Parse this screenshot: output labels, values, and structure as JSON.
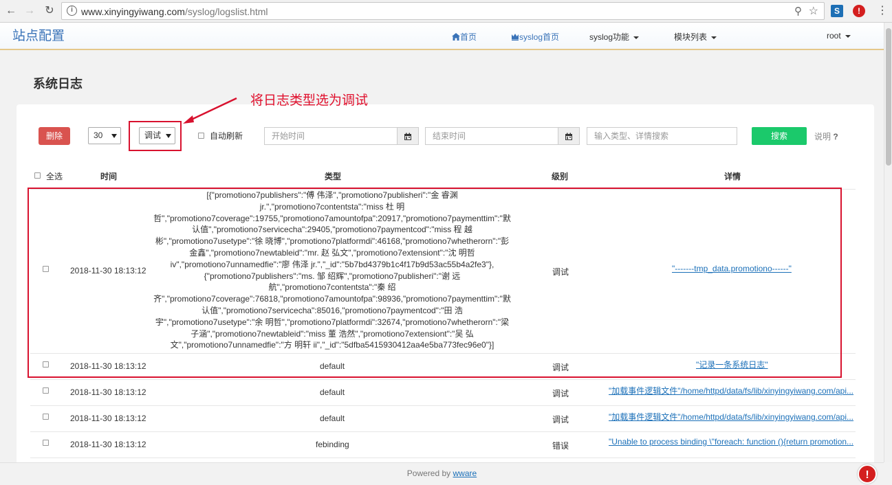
{
  "browser": {
    "url_host": "www.xinyingyiwang.com",
    "url_path": "/syslog/logslist.html",
    "ext1_label": "S",
    "ext2_label": "!"
  },
  "site": {
    "brand": "站点配置",
    "nav": {
      "home": "首页",
      "syslog_home": "syslog首页",
      "syslog_func": "syslog功能",
      "modules": "模块列表",
      "user": "root"
    }
  },
  "page": {
    "title": "系统日志",
    "annotation": "将日志类型选为调试"
  },
  "toolbar": {
    "delete_label": "删除",
    "page_size": "30",
    "level_filter": "调试",
    "auto_refresh_label": "自动刷新",
    "start_placeholder": "开始时间",
    "end_placeholder": "结束时间",
    "search_placeholder": "输入类型、详情搜索",
    "search_label": "搜索",
    "help_label": "说明",
    "help_mark": "?"
  },
  "table": {
    "headers": {
      "select_all": "全选",
      "time": "时间",
      "type": "类型",
      "level": "级别",
      "detail": "详情"
    },
    "rows": [
      {
        "time": "2018-11-30 18:13:12",
        "type": "[{\"promotiono7publishers\":\"傅 伟泽\",\"promotiono7publisheri\":\"金 睿渊 jr.\",\"promotiono7contentsta\":\"miss 杜 明哲\",\"promotiono7coverage\":19755,\"promotiono7amountofpa\":20917,\"promotiono7paymenttim\":\"默认值\",\"promotiono7servicecha\":29405,\"promotiono7paymentcod\":\"miss 程 越彬\",\"promotiono7usetype\":\"徐 晓博\",\"promotiono7platformdi\":46168,\"promotiono7whetherorn\":\"彭 金鑫\",\"promotiono7newtableid\":\"mr. 赵 弘文\",\"promotiono7extensiont\":\"沈 明哲 iv\",\"promotiono7unnamedfie\":\"廖 伟泽 jr.\",\"_id\":\"5b7bd4379b1c4f17b9d53ac55b4a2fe3\"},{\"promotiono7publishers\":\"ms. 邹 绍辉\",\"promotiono7publisheri\":\"谢 远航\",\"promotiono7contentsta\":\"秦 绍齐\",\"promotiono7coverage\":76818,\"promotiono7amountofpa\":98936,\"promotiono7paymenttim\":\"默认值\",\"promotiono7servicecha\":85016,\"promotiono7paymentcod\":\"田 浩宇\",\"promotiono7usetype\":\"余 明哲\",\"promotiono7platformdi\":32674,\"promotiono7whetherorn\":\"梁 子涵\",\"promotiono7newtableid\":\"miss 董 浩然\",\"promotiono7extensiont\":\"吴 弘文\",\"promotiono7unnamedfie\":\"方 明轩 ii\",\"_id\":\"5dfba5415930412aa4e5ba773fec96e0\"}]",
        "level": "调试",
        "detail": "\"-------tmp_data.promotiono------\""
      },
      {
        "time": "2018-11-30 18:13:12",
        "type": "default",
        "level": "调试",
        "detail": "\"记录一条系统日志\""
      },
      {
        "time": "2018-11-30 18:13:12",
        "type": "default",
        "level": "调试",
        "detail": "\"加载事件逻辑文件\"/home/httpd/data/fs/lib/xinyingyiwang.com/api..."
      },
      {
        "time": "2018-11-30 18:13:12",
        "type": "default",
        "level": "调试",
        "detail": "\"加载事件逻辑文件\"/home/httpd/data/fs/lib/xinyingyiwang.com/api..."
      },
      {
        "time": "2018-11-30 18:13:12",
        "type": "febinding",
        "level": "错误",
        "detail": "\"Unable to process binding \\\"foreach: function (){return promotion..."
      }
    ]
  },
  "footer": {
    "prefix": "Powered by",
    "link": "wware"
  },
  "colors": {
    "accent_blue": "#3a73b8",
    "danger": "#d9534f",
    "success": "#1bc96b",
    "annotation_red": "#e0102d"
  }
}
